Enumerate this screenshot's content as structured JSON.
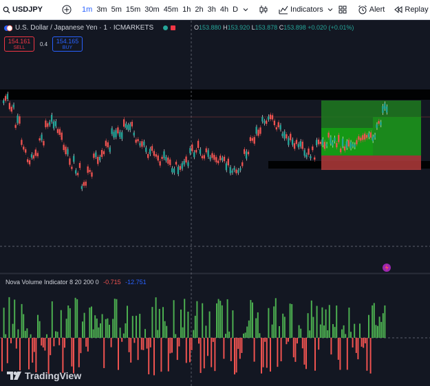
{
  "toolbar": {
    "symbol": "USDJPY",
    "timeframes": [
      "1m",
      "3m",
      "5m",
      "15m",
      "30m",
      "45m",
      "1h",
      "2h",
      "3h",
      "4h",
      "D"
    ],
    "active_timeframe": "1m",
    "indicators_label": "Indicators",
    "alert_label": "Alert",
    "replay_label": "Replay"
  },
  "legend": {
    "instrument": "U.S. Dollar / Japanese Yen · 1 · ICMARKETS",
    "open_label": "O",
    "open": "153.880",
    "high_label": "H",
    "high": "153.920",
    "low_label": "L",
    "low": "153.878",
    "close_label": "C",
    "close": "153.898",
    "change": "+0.020 (+0.01%)"
  },
  "trade": {
    "sell_price": "154.161",
    "sell_label": "SELL",
    "spread": "0.4",
    "buy_price": "154.165",
    "buy_label": "BUY"
  },
  "indicator": {
    "name": "Nova Volume Indicator 8 20 200 0",
    "value1": "-0.715",
    "value2": "-12.751"
  },
  "branding": "TradingView",
  "colors": {
    "up": "#26a69a",
    "down": "#ef5350",
    "accent": "#2962ff",
    "bg": "#131722",
    "green_zone": "#1e8e1e",
    "red_zone": "#a33a3a"
  }
}
